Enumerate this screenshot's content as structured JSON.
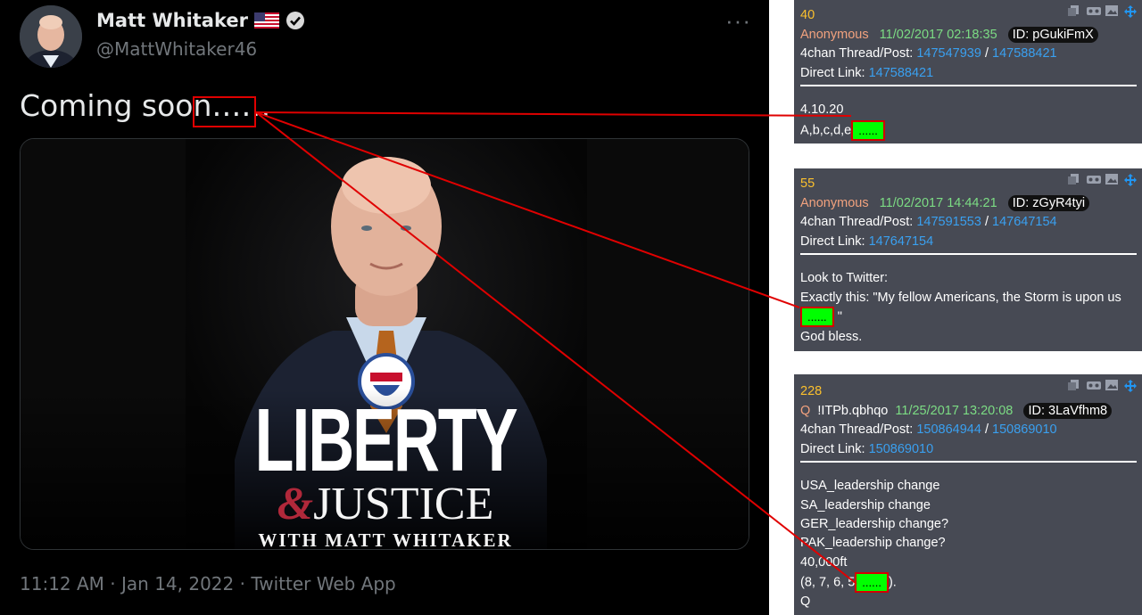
{
  "tweet": {
    "display_name": "Matt Whitaker",
    "handle": "@MattWhitaker46",
    "text": "Coming soon……",
    "more_icon": "more-horizontal-icon",
    "media": {
      "title_line1": "LIBERTY",
      "title_amp": "&",
      "title_line2": "JUSTICE",
      "subtitle": "WITH MATT WHITAKER"
    },
    "timestamp": "11:12 AM · Jan 14, 2022 · Twitter Web App"
  },
  "posts": [
    {
      "number": "40",
      "author": "Anonymous",
      "date": "11/02/2017 02:18:35",
      "id": "ID: pGukiFmX",
      "thread_label": "4chan Thread/Post:",
      "thread_id": "147547939",
      "post_id": "147588421",
      "direct_label": "Direct Link:",
      "direct_id": "147588421",
      "body_lines": [
        "4.10.20",
        "A,b,c,d,e"
      ],
      "highlight": "......"
    },
    {
      "number": "55",
      "author": "Anonymous",
      "date": "11/02/2017 14:44:21",
      "id": "ID: zGyR4tyi",
      "thread_label": "4chan Thread/Post:",
      "thread_id": "147591553",
      "post_id": "147647154",
      "direct_label": "Direct Link:",
      "direct_id": "147647154",
      "body_lines": [
        "Look to Twitter:",
        "Exactly this: \"My fellow Americans, the Storm is upon us",
        "\"",
        "God bless."
      ],
      "highlight": "......"
    },
    {
      "number": "228",
      "author": "Q",
      "tripcode": "!ITPb.qbhqo",
      "date": "11/25/2017 13:20:08",
      "id": "ID: 3LaVfhm8",
      "thread_label": "4chan Thread/Post:",
      "thread_id": "150864944",
      "post_id": "150869010",
      "direct_label": "Direct Link:",
      "direct_id": "150869010",
      "body_lines": [
        "USA_leadership change",
        "SA_leadership change",
        "GER_leadership change?",
        "PAK_leadership change?",
        "40,000ft",
        "(8, 7, 6, 5",
        ").",
        "Q"
      ],
      "highlight": "......"
    }
  ],
  "slash": "/",
  "toolbar_icons": [
    "copy-icon",
    "vr-view-icon",
    "image-icon",
    "move-icon"
  ],
  "colors": {
    "annotation_red": "#e00000",
    "highlight_green": "#00ff00",
    "card_bg": "#474a54",
    "post_number": "#fbc02d",
    "author": "#f2a27e",
    "date": "#7cdc84",
    "link": "#3aa0f0"
  }
}
